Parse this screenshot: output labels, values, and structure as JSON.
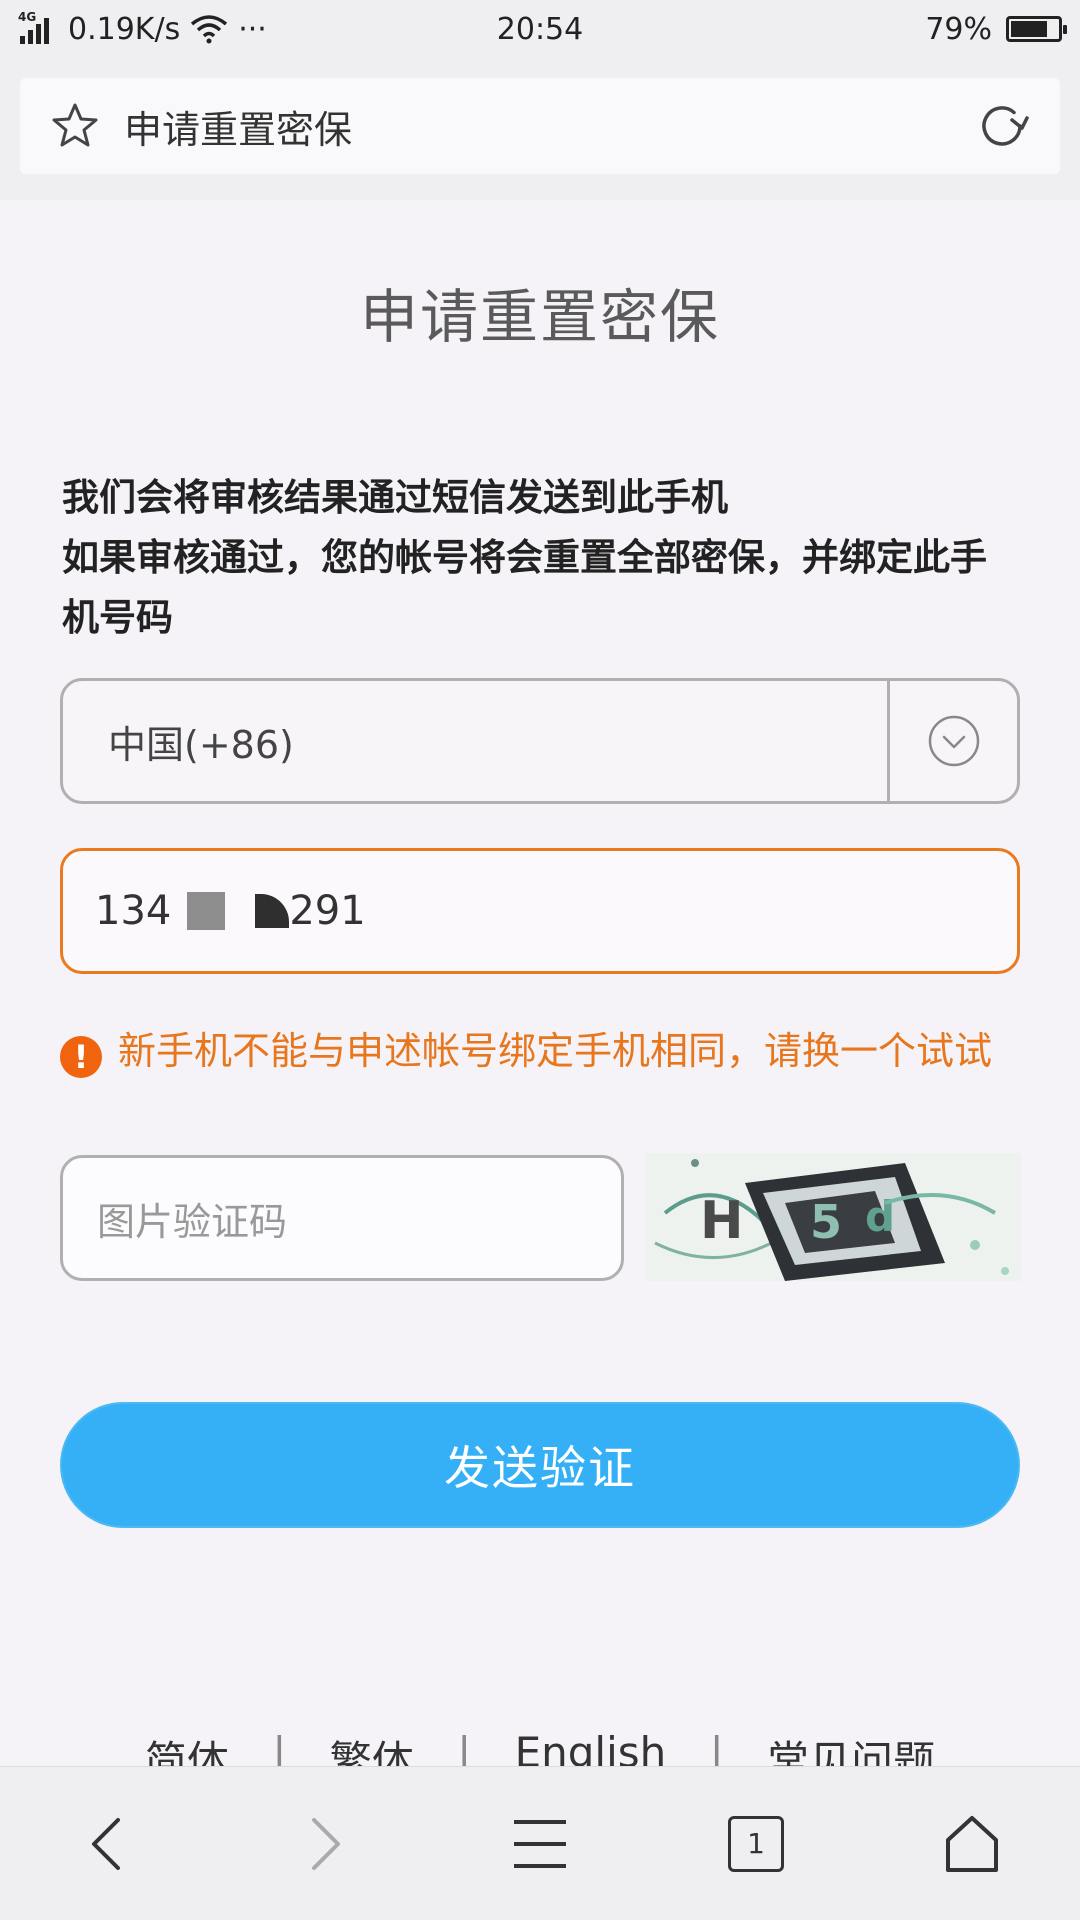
{
  "status_bar": {
    "network": "4G",
    "speed": "0.19K/s",
    "more": "···",
    "time": "20:54",
    "battery_percent": "79%",
    "battery_level": 0.79
  },
  "address_bar": {
    "title": "申请重置密保",
    "star_icon": "star-icon",
    "refresh_icon": "refresh-icon"
  },
  "page": {
    "title": "申请重置密保",
    "notice_line1": "我们会将审核结果通过短信发送到此手机",
    "notice_line2": "如果审核通过，您的帐号将会重置全部密保，并绑定此手机号码"
  },
  "form": {
    "country_value": "中国(+86)",
    "phone_prefix": "134",
    "phone_suffix": "291",
    "error_text": "新手机不能与申述帐号绑定手机相同，请换一个试试",
    "captcha_placeholder": "图片验证码",
    "send_label": "发送验证"
  },
  "languages": {
    "simplified": "简体",
    "traditional": "繁体",
    "english": "English",
    "faq": "常见问题",
    "separator": "|"
  },
  "bottom_nav": {
    "tabs_count": "1"
  },
  "colors": {
    "accent_blue": "#35b0f6",
    "error_orange": "#e8761c",
    "focus_border": "#ea7a1f"
  }
}
